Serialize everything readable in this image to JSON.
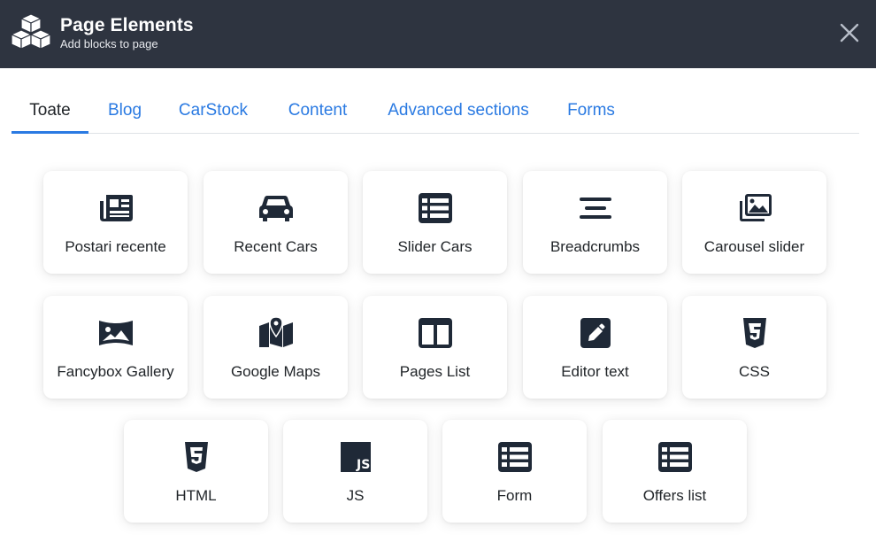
{
  "header": {
    "title": "Page Elements",
    "subtitle": "Add blocks to page",
    "logo_icon": "cubes-icon",
    "close_icon": "close-icon"
  },
  "tabs": [
    {
      "label": "Toate",
      "active": true
    },
    {
      "label": "Blog"
    },
    {
      "label": "CarStock"
    },
    {
      "label": "Content"
    },
    {
      "label": "Advanced sections"
    },
    {
      "label": "Forms"
    }
  ],
  "blocks": [
    {
      "label": "Postari recente",
      "icon": "newspaper-icon"
    },
    {
      "label": "Recent Cars",
      "icon": "car-icon"
    },
    {
      "label": "Slider Cars",
      "icon": "list-icon"
    },
    {
      "label": "Breadcrumbs",
      "icon": "align-center-icon"
    },
    {
      "label": "Carousel slider",
      "icon": "images-icon"
    },
    {
      "label": "Fancybox Gallery",
      "icon": "panorama-icon"
    },
    {
      "label": "Google Maps",
      "icon": "map-location-icon"
    },
    {
      "label": "Pages List",
      "icon": "columns-icon"
    },
    {
      "label": "Editor text",
      "icon": "pen-square-icon"
    },
    {
      "label": "CSS",
      "icon": "css3-icon"
    },
    {
      "label": "HTML",
      "icon": "html5-icon"
    },
    {
      "label": "JS",
      "icon": "js-icon"
    },
    {
      "label": "Form",
      "icon": "list-icon"
    },
    {
      "label": "Offers list",
      "icon": "list-icon"
    }
  ],
  "colors": {
    "header_bg": "#2e3440",
    "accent": "#2a7ae2",
    "icon": "#1f2937"
  }
}
